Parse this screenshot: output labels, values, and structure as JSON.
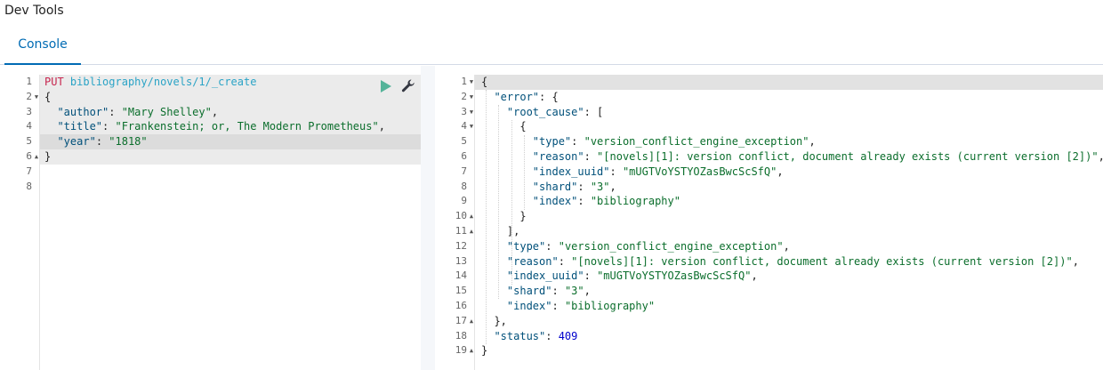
{
  "app": {
    "title": "Dev Tools"
  },
  "tabs": [
    {
      "label": "Console"
    }
  ],
  "request": {
    "lines": [
      {
        "n": "1",
        "fold": "",
        "parts": [
          {
            "t": "PUT",
            "c": "k-method"
          },
          {
            "t": " ",
            "c": "k-punc"
          },
          {
            "t": "bibliography/novels/1/_create",
            "c": "k-url"
          }
        ]
      },
      {
        "n": "2",
        "fold": "▼",
        "parts": [
          {
            "t": "{",
            "c": "k-punc"
          }
        ]
      },
      {
        "n": "3",
        "fold": "",
        "parts": [
          {
            "t": "  ",
            "c": "k-punc"
          },
          {
            "t": "\"author\"",
            "c": "k-key"
          },
          {
            "t": ": ",
            "c": "k-punc"
          },
          {
            "t": "\"Mary Shelley\"",
            "c": "k-str"
          },
          {
            "t": ",",
            "c": "k-punc"
          }
        ]
      },
      {
        "n": "4",
        "fold": "",
        "parts": [
          {
            "t": "  ",
            "c": "k-punc"
          },
          {
            "t": "\"title\"",
            "c": "k-key"
          },
          {
            "t": ": ",
            "c": "k-punc"
          },
          {
            "t": "\"Frankenstein; or, The Modern Prometheus\"",
            "c": "k-str"
          },
          {
            "t": ",",
            "c": "k-punc"
          }
        ]
      },
      {
        "n": "5",
        "fold": "",
        "parts": [
          {
            "t": "  ",
            "c": "k-punc"
          },
          {
            "t": "\"year\"",
            "c": "k-key"
          },
          {
            "t": ": ",
            "c": "k-punc"
          },
          {
            "t": "\"1818\"",
            "c": "k-str"
          }
        ]
      },
      {
        "n": "6",
        "fold": "▲",
        "parts": [
          {
            "t": "}",
            "c": "k-punc"
          }
        ]
      },
      {
        "n": "7",
        "fold": "",
        "parts": []
      },
      {
        "n": "8",
        "fold": "",
        "parts": []
      }
    ]
  },
  "response": {
    "lines": [
      {
        "n": "1",
        "fold": "▼",
        "parts": [
          {
            "t": "{",
            "c": "k-punc"
          }
        ]
      },
      {
        "n": "2",
        "fold": "▼",
        "parts": [
          {
            "t": "  ",
            "c": "k-punc"
          },
          {
            "t": "\"error\"",
            "c": "k-key"
          },
          {
            "t": ": {",
            "c": "k-punc"
          }
        ]
      },
      {
        "n": "3",
        "fold": "▼",
        "parts": [
          {
            "t": "    ",
            "c": "k-punc"
          },
          {
            "t": "\"root_cause\"",
            "c": "k-key"
          },
          {
            "t": ": [",
            "c": "k-punc"
          }
        ]
      },
      {
        "n": "4",
        "fold": "▼",
        "parts": [
          {
            "t": "      {",
            "c": "k-punc"
          }
        ]
      },
      {
        "n": "5",
        "fold": "",
        "parts": [
          {
            "t": "        ",
            "c": "k-punc"
          },
          {
            "t": "\"type\"",
            "c": "k-key"
          },
          {
            "t": ": ",
            "c": "k-punc"
          },
          {
            "t": "\"version_conflict_engine_exception\"",
            "c": "k-str"
          },
          {
            "t": ",",
            "c": "k-punc"
          }
        ]
      },
      {
        "n": "6",
        "fold": "",
        "parts": [
          {
            "t": "        ",
            "c": "k-punc"
          },
          {
            "t": "\"reason\"",
            "c": "k-key"
          },
          {
            "t": ": ",
            "c": "k-punc"
          },
          {
            "t": "\"[novels][1]: version conflict, document already exists (current version [2])\"",
            "c": "k-str"
          },
          {
            "t": ",",
            "c": "k-punc"
          }
        ]
      },
      {
        "n": "7",
        "fold": "",
        "parts": [
          {
            "t": "        ",
            "c": "k-punc"
          },
          {
            "t": "\"index_uuid\"",
            "c": "k-key"
          },
          {
            "t": ": ",
            "c": "k-punc"
          },
          {
            "t": "\"mUGTVoYSTYOZasBwcScSfQ\"",
            "c": "k-str"
          },
          {
            "t": ",",
            "c": "k-punc"
          }
        ]
      },
      {
        "n": "8",
        "fold": "",
        "parts": [
          {
            "t": "        ",
            "c": "k-punc"
          },
          {
            "t": "\"shard\"",
            "c": "k-key"
          },
          {
            "t": ": ",
            "c": "k-punc"
          },
          {
            "t": "\"3\"",
            "c": "k-str"
          },
          {
            "t": ",",
            "c": "k-punc"
          }
        ]
      },
      {
        "n": "9",
        "fold": "",
        "parts": [
          {
            "t": "        ",
            "c": "k-punc"
          },
          {
            "t": "\"index\"",
            "c": "k-key"
          },
          {
            "t": ": ",
            "c": "k-punc"
          },
          {
            "t": "\"bibliography\"",
            "c": "k-str"
          }
        ]
      },
      {
        "n": "10",
        "fold": "▲",
        "parts": [
          {
            "t": "      }",
            "c": "k-punc"
          }
        ]
      },
      {
        "n": "11",
        "fold": "▲",
        "parts": [
          {
            "t": "    ],",
            "c": "k-punc"
          }
        ]
      },
      {
        "n": "12",
        "fold": "",
        "parts": [
          {
            "t": "    ",
            "c": "k-punc"
          },
          {
            "t": "\"type\"",
            "c": "k-key"
          },
          {
            "t": ": ",
            "c": "k-punc"
          },
          {
            "t": "\"version_conflict_engine_exception\"",
            "c": "k-str"
          },
          {
            "t": ",",
            "c": "k-punc"
          }
        ]
      },
      {
        "n": "13",
        "fold": "",
        "parts": [
          {
            "t": "    ",
            "c": "k-punc"
          },
          {
            "t": "\"reason\"",
            "c": "k-key"
          },
          {
            "t": ": ",
            "c": "k-punc"
          },
          {
            "t": "\"[novels][1]: version conflict, document already exists (current version [2])\"",
            "c": "k-str"
          },
          {
            "t": ",",
            "c": "k-punc"
          }
        ]
      },
      {
        "n": "14",
        "fold": "",
        "parts": [
          {
            "t": "    ",
            "c": "k-punc"
          },
          {
            "t": "\"index_uuid\"",
            "c": "k-key"
          },
          {
            "t": ": ",
            "c": "k-punc"
          },
          {
            "t": "\"mUGTVoYSTYOZasBwcScSfQ\"",
            "c": "k-str"
          },
          {
            "t": ",",
            "c": "k-punc"
          }
        ]
      },
      {
        "n": "15",
        "fold": "",
        "parts": [
          {
            "t": "    ",
            "c": "k-punc"
          },
          {
            "t": "\"shard\"",
            "c": "k-key"
          },
          {
            "t": ": ",
            "c": "k-punc"
          },
          {
            "t": "\"3\"",
            "c": "k-str"
          },
          {
            "t": ",",
            "c": "k-punc"
          }
        ]
      },
      {
        "n": "16",
        "fold": "",
        "parts": [
          {
            "t": "    ",
            "c": "k-punc"
          },
          {
            "t": "\"index\"",
            "c": "k-key"
          },
          {
            "t": ": ",
            "c": "k-punc"
          },
          {
            "t": "\"bibliography\"",
            "c": "k-str"
          }
        ]
      },
      {
        "n": "17",
        "fold": "▲",
        "parts": [
          {
            "t": "  },",
            "c": "k-punc"
          }
        ]
      },
      {
        "n": "18",
        "fold": "",
        "parts": [
          {
            "t": "  ",
            "c": "k-punc"
          },
          {
            "t": "\"status\"",
            "c": "k-key"
          },
          {
            "t": ": ",
            "c": "k-punc"
          },
          {
            "t": "409",
            "c": "k-num"
          }
        ]
      },
      {
        "n": "19",
        "fold": "▲",
        "parts": [
          {
            "t": "}",
            "c": "k-punc"
          }
        ]
      }
    ]
  },
  "icons": {
    "run": "play-icon",
    "settings": "wrench-icon"
  },
  "colors": {
    "accent": "#006bb4",
    "run": "#54b399",
    "method": "#c7254e",
    "url": "#2aa3c6",
    "string": "#0b6e2c",
    "number": "#0000cc",
    "key": "#00507a"
  }
}
